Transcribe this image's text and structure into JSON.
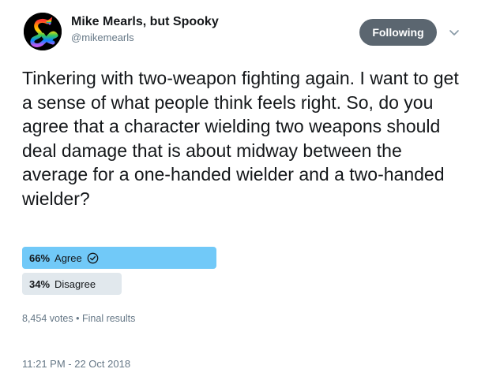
{
  "author": {
    "display_name": "Mike Mearls, but Spooky",
    "handle": "@mikemearls"
  },
  "follow_button": {
    "label": "Following"
  },
  "icons": {
    "avatar": "rainbow-ampersand-logo",
    "caret": "chevron-down-icon",
    "winner": "check-circle-icon"
  },
  "tweet": {
    "text": "Tinkering with two-weapon fighting again. I want to get a sense of what people think feels right. So, do you agree that a character wielding two weapons should deal damage that is about midway between the average for a one-handed wielder and a two-handed wielder?"
  },
  "poll": {
    "options": [
      {
        "percent_label": "66%",
        "percent": 66,
        "label": "Agree",
        "winner": true
      },
      {
        "percent_label": "34%",
        "percent": 34,
        "label": "Disagree",
        "winner": false
      }
    ],
    "votes": "8,454 votes",
    "separator": "•",
    "status": "Final results"
  },
  "timestamp": "11:21 PM - 22 Oct 2018",
  "colors": {
    "winner_bar": "#71c9f8",
    "other_bar": "#e1e8ed",
    "follow_button": "#5b6670",
    "secondary_text": "#657786"
  }
}
